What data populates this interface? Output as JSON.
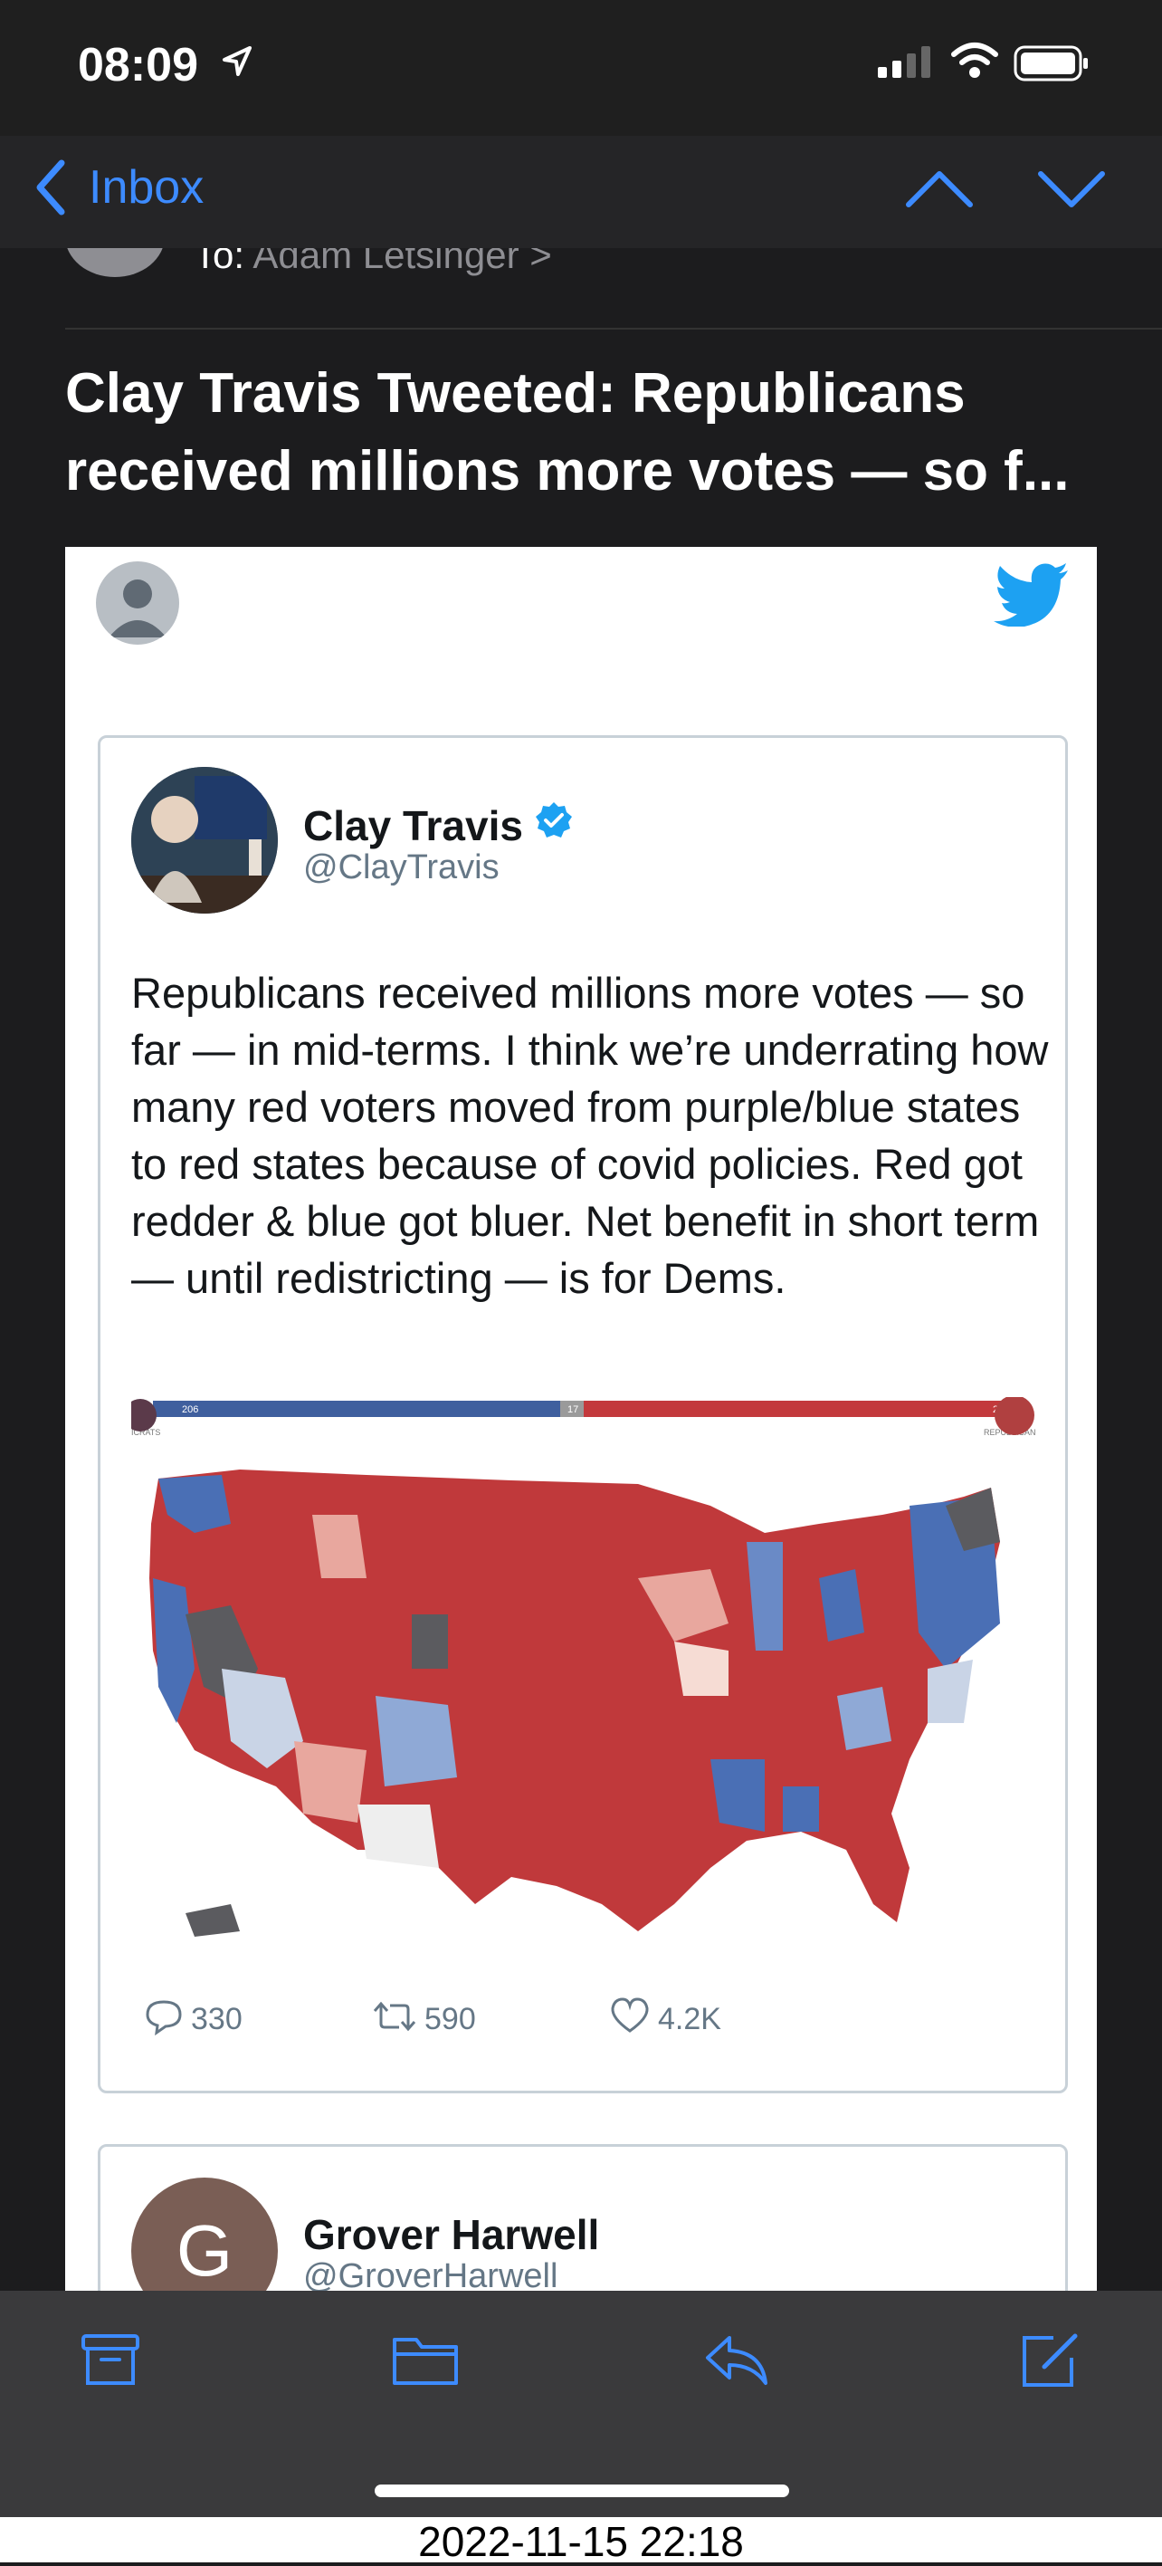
{
  "status": {
    "time": "08:09"
  },
  "nav": {
    "back_label": "Inbox"
  },
  "header": {
    "to_label": "To:",
    "to_name": "Adam Letsinger",
    "to_chevron": ">"
  },
  "subject": "Clay Travis Tweeted: Republicans received millions more votes — so f...",
  "tweet": {
    "name": "Clay Travis",
    "handle": "@ClayTravis",
    "text": "Republicans received millions more votes — so far — in mid-terms. I think we’re underrating how many red voters moved from purple/blue states to red states because of covid policies. Red got redder & blue got bluer. Net benefit in short term — until redistricting — is for Dems.",
    "replies": "330",
    "retweets": "590",
    "likes": "4.2K",
    "map_bar": {
      "left": "206",
      "mid": "17",
      "right": "212",
      "left_label": "ICRATS",
      "right_label": "REPUBLICAN"
    }
  },
  "tweet2": {
    "initial": "G",
    "name": "Grover Harwell",
    "handle": "@GroverHarwell"
  },
  "footer": {
    "timestamp": "2022-11-15 22:18"
  },
  "colors": {
    "accent": "#3d8bff",
    "twitter": "#1da1f2",
    "gop_red": "#c0393b",
    "dem_blue": "#4a6fb5"
  }
}
